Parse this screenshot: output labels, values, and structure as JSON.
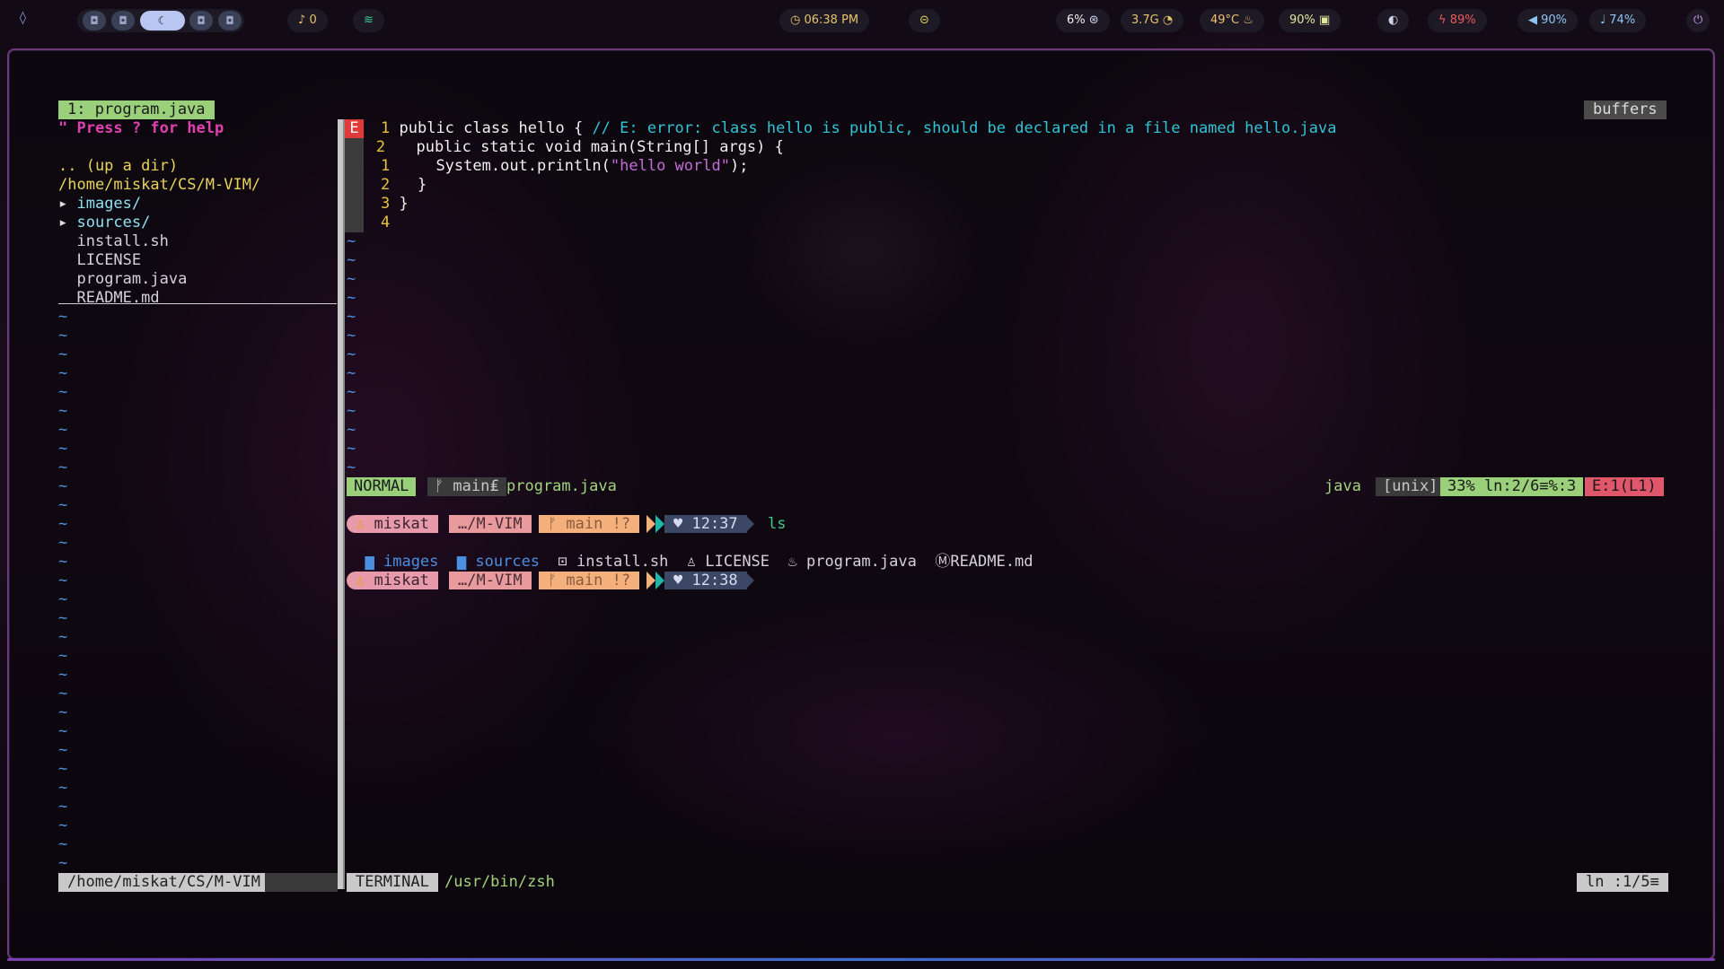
{
  "topbar": {
    "notifications": "0",
    "clock": "06:38 PM",
    "cpu": "6%",
    "memory": "3.7G",
    "temperature": "49°C",
    "disk": "90%",
    "battery": "89%",
    "volume": "90%",
    "mic": "74%"
  },
  "nerdtree": {
    "tab_label": "1: program.java",
    "help": "\" Press ? for help",
    "up_dir": ".. (up a dir)",
    "cwd": "/home/miskat/CS/M-VIM/",
    "entries": [
      {
        "marker": "▸ ",
        "name": "images/"
      },
      {
        "marker": "▸ ",
        "name": "sources/"
      },
      {
        "marker": "  ",
        "name": "install.sh"
      },
      {
        "marker": "  ",
        "name": "LICENSE"
      },
      {
        "marker": "  ",
        "name": "program.java"
      },
      {
        "marker": "  ",
        "name": "README.md"
      }
    ],
    "bottom_path": "/home/miskat/CS/M-VIM"
  },
  "buffers_label": "buffers",
  "editor": {
    "sign": "E",
    "lines": [
      {
        "num": "1",
        "code": "public class hello { ",
        "comment": "// E: error: class hello is public, should be declared in a file named hello.java"
      },
      {
        "num": "2",
        "code": "  public static void main(String[] args) {",
        "comment": ""
      },
      {
        "num": "1",
        "code": "    System.out.println(",
        "string": "\"hello world\"",
        "tail": ");"
      },
      {
        "num": "2",
        "code": "  }",
        "comment": ""
      },
      {
        "num": "3",
        "code": "}",
        "comment": ""
      },
      {
        "num": "4",
        "code": "",
        "comment": ""
      }
    ]
  },
  "statusline": {
    "mode": "NORMAL",
    "branch": "ᚠ main₤",
    "filename": "program.java",
    "filetype": "java",
    "fileformat": "[unix]",
    "position": "33% ln:2/6≡%:3",
    "errors": "E:1(L1)"
  },
  "terminal": {
    "prompt1": {
      "user": "miskat",
      "dir": "…/M-VIM",
      "git": "ᚠ main !?",
      "time": "♥ 12:37",
      "command": "ls"
    },
    "ls_output": [
      {
        "icon": "▆",
        "name": "images",
        "kind": "dir"
      },
      {
        "icon": "▆",
        "name": "sources",
        "kind": "dir"
      },
      {
        "icon": "⊡",
        "name": "install.sh",
        "kind": "file"
      },
      {
        "icon": "♙",
        "name": "LICENSE",
        "kind": "file"
      },
      {
        "icon": "♨",
        "name": "program.java",
        "kind": "file"
      },
      {
        "icon": "Ⓜ",
        "name": "README.md",
        "kind": "file"
      }
    ],
    "prompt2": {
      "user": "miskat",
      "dir": "…/M-VIM",
      "git": "ᚠ main !?",
      "time": "♥ 12:38"
    },
    "tag": "TERMINAL",
    "shell": "/usr/bin/zsh",
    "line_info": "ln :1/5≡"
  }
}
